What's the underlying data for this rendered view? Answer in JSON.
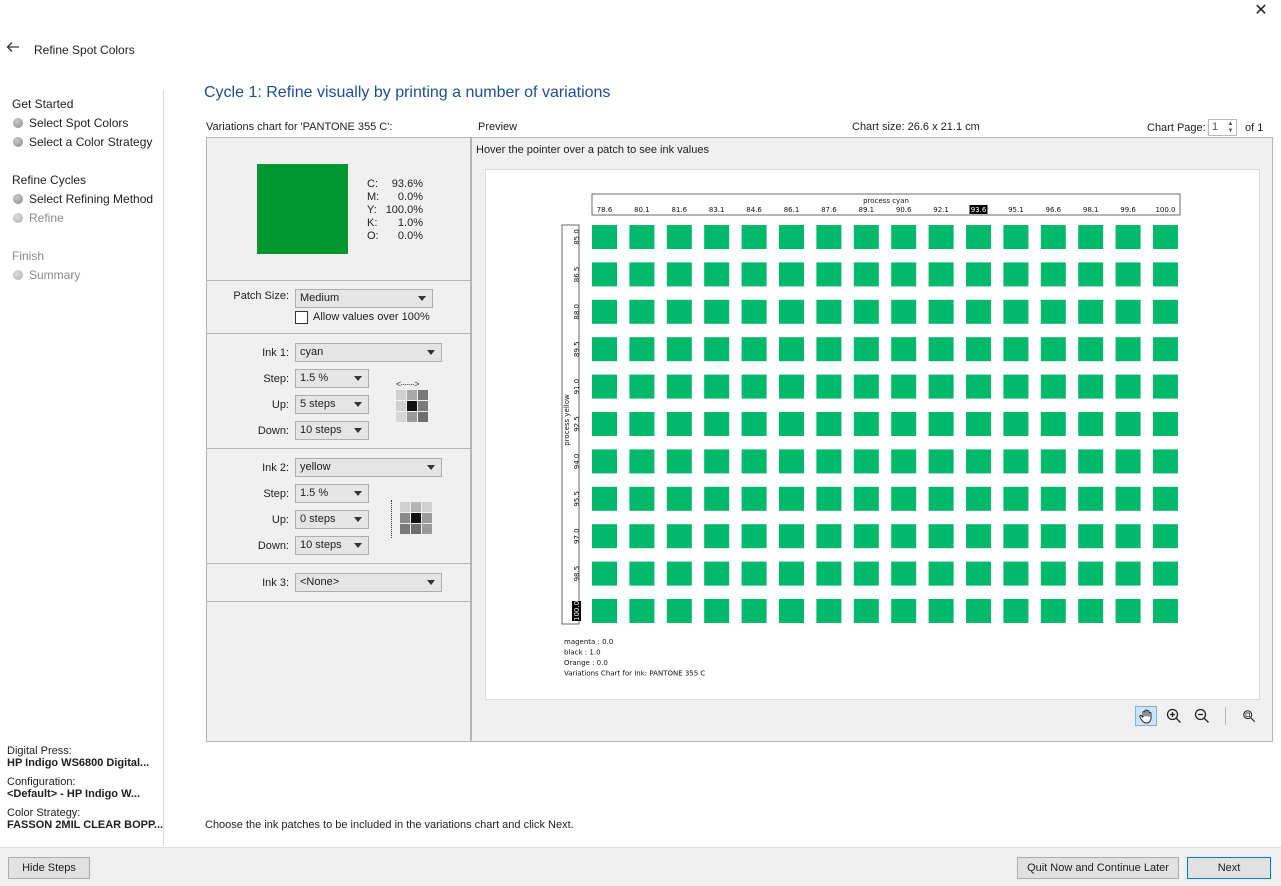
{
  "window": {
    "title": "Refine Spot Colors",
    "close_glyph": "✕"
  },
  "sidebar": {
    "sections": [
      {
        "heading": "Get Started",
        "items": [
          "Select Spot Colors",
          "Select a Color Strategy"
        ]
      },
      {
        "heading": "Refine Cycles",
        "items": [
          "Select Refining Method",
          "Refine"
        ]
      },
      {
        "heading": "Finish",
        "items": [
          "Summary"
        ]
      }
    ],
    "meta": {
      "press_label": "Digital Press:",
      "press_value": "HP Indigo WS6800 Digital...",
      "config_label": "Configuration:",
      "config_value": "<Default> - HP Indigo W...",
      "strategy_label": "Color Strategy:",
      "strategy_value": "FASSON 2MIL CLEAR BOPP..."
    }
  },
  "main": {
    "title": "Cycle 1: Refine visually by printing a number of variations",
    "variations_label": "Variations chart for 'PANTONE 355 C':",
    "preview_label": "Preview",
    "chart_size": "Chart size: 26.6 x 21.1 cm",
    "chart_page_label": "Chart Page:",
    "chart_page_value": "1",
    "chart_page_of": "of 1",
    "hover_hint": "Hover the pointer over a patch to see ink values",
    "instruction": "Choose the ink patches to be included in the variations chart and click Next."
  },
  "ink_values": {
    "swatch_color": "#00982e",
    "lines": [
      {
        "k": "C:",
        "v": "93.6%"
      },
      {
        "k": "M:",
        "v": "0.0%"
      },
      {
        "k": "Y:",
        "v": "100.0%"
      },
      {
        "k": "K:",
        "v": "1.0%"
      },
      {
        "k": "O:",
        "v": "0.0%"
      }
    ]
  },
  "controls": {
    "patch_size_label": "Patch Size:",
    "patch_size_value": "Medium",
    "allow_over_label": "Allow values over 100%",
    "ink1": {
      "label": "Ink 1:",
      "value": "cyan",
      "step_label": "Step:",
      "step": "1.5 %",
      "up_label": "Up:",
      "up": "5 steps",
      "down_label": "Down:",
      "down": "10 steps"
    },
    "ink2": {
      "label": "Ink 2:",
      "value": "yellow",
      "step_label": "Step:",
      "step": "1.5 %",
      "up_label": "Up:",
      "up": "0 steps",
      "down_label": "Down:",
      "down": "10 steps"
    },
    "ink3": {
      "label": "Ink 3:",
      "value": "<None>"
    }
  },
  "chart_data": {
    "type": "heatmap",
    "patch_color": "#00b96b",
    "x_axis_title": "process cyan",
    "x_values": [
      "78.6",
      "80.1",
      "81.6",
      "83.1",
      "84.6",
      "86.1",
      "87.6",
      "89.1",
      "90.6",
      "92.1",
      "93.6",
      "95.1",
      "96.6",
      "98.1",
      "99.6",
      "100.0"
    ],
    "x_highlight": "93.6",
    "y_axis_title": "process yellow",
    "y_values": [
      "85.0",
      "86.5",
      "88.0",
      "89.5",
      "91.0",
      "92.5",
      "94.0",
      "95.5",
      "97.0",
      "98.5",
      "100.0"
    ],
    "y_highlight": "100.0",
    "notes": [
      "magenta : 0.0",
      "black : 1.0",
      "Orange : 0.0",
      "Variations Chart for Ink: PANTONE 355 C"
    ]
  },
  "toolbar": {
    "tools": [
      "hand-icon",
      "zoom-in-icon",
      "zoom-out-icon",
      "zoom-fit-icon"
    ]
  },
  "footer": {
    "hide_steps": "Hide Steps",
    "quit_later": "Quit Now and Continue Later",
    "next": "Next"
  }
}
